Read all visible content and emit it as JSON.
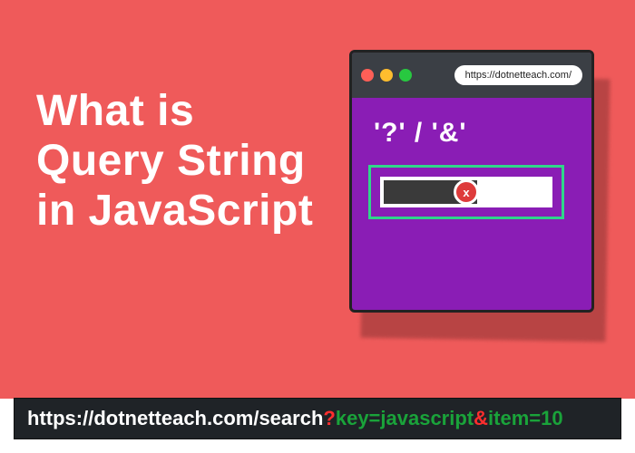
{
  "hero": {
    "headline_l1": "What is",
    "headline_l2": "Query String",
    "headline_l3": "in JavaScript"
  },
  "browser": {
    "url": "https://dotnetteach.com/",
    "symbols": "'?' / '&'",
    "close_label": "x",
    "dots": {
      "red": "#ff5f57",
      "yellow": "#ffbd2e",
      "green": "#28c840"
    }
  },
  "url_example": {
    "base": "https://dotnetteach.com/search",
    "qmark": "?",
    "pair1": "key=javascript",
    "amp": "&",
    "pair2": "item=10"
  }
}
